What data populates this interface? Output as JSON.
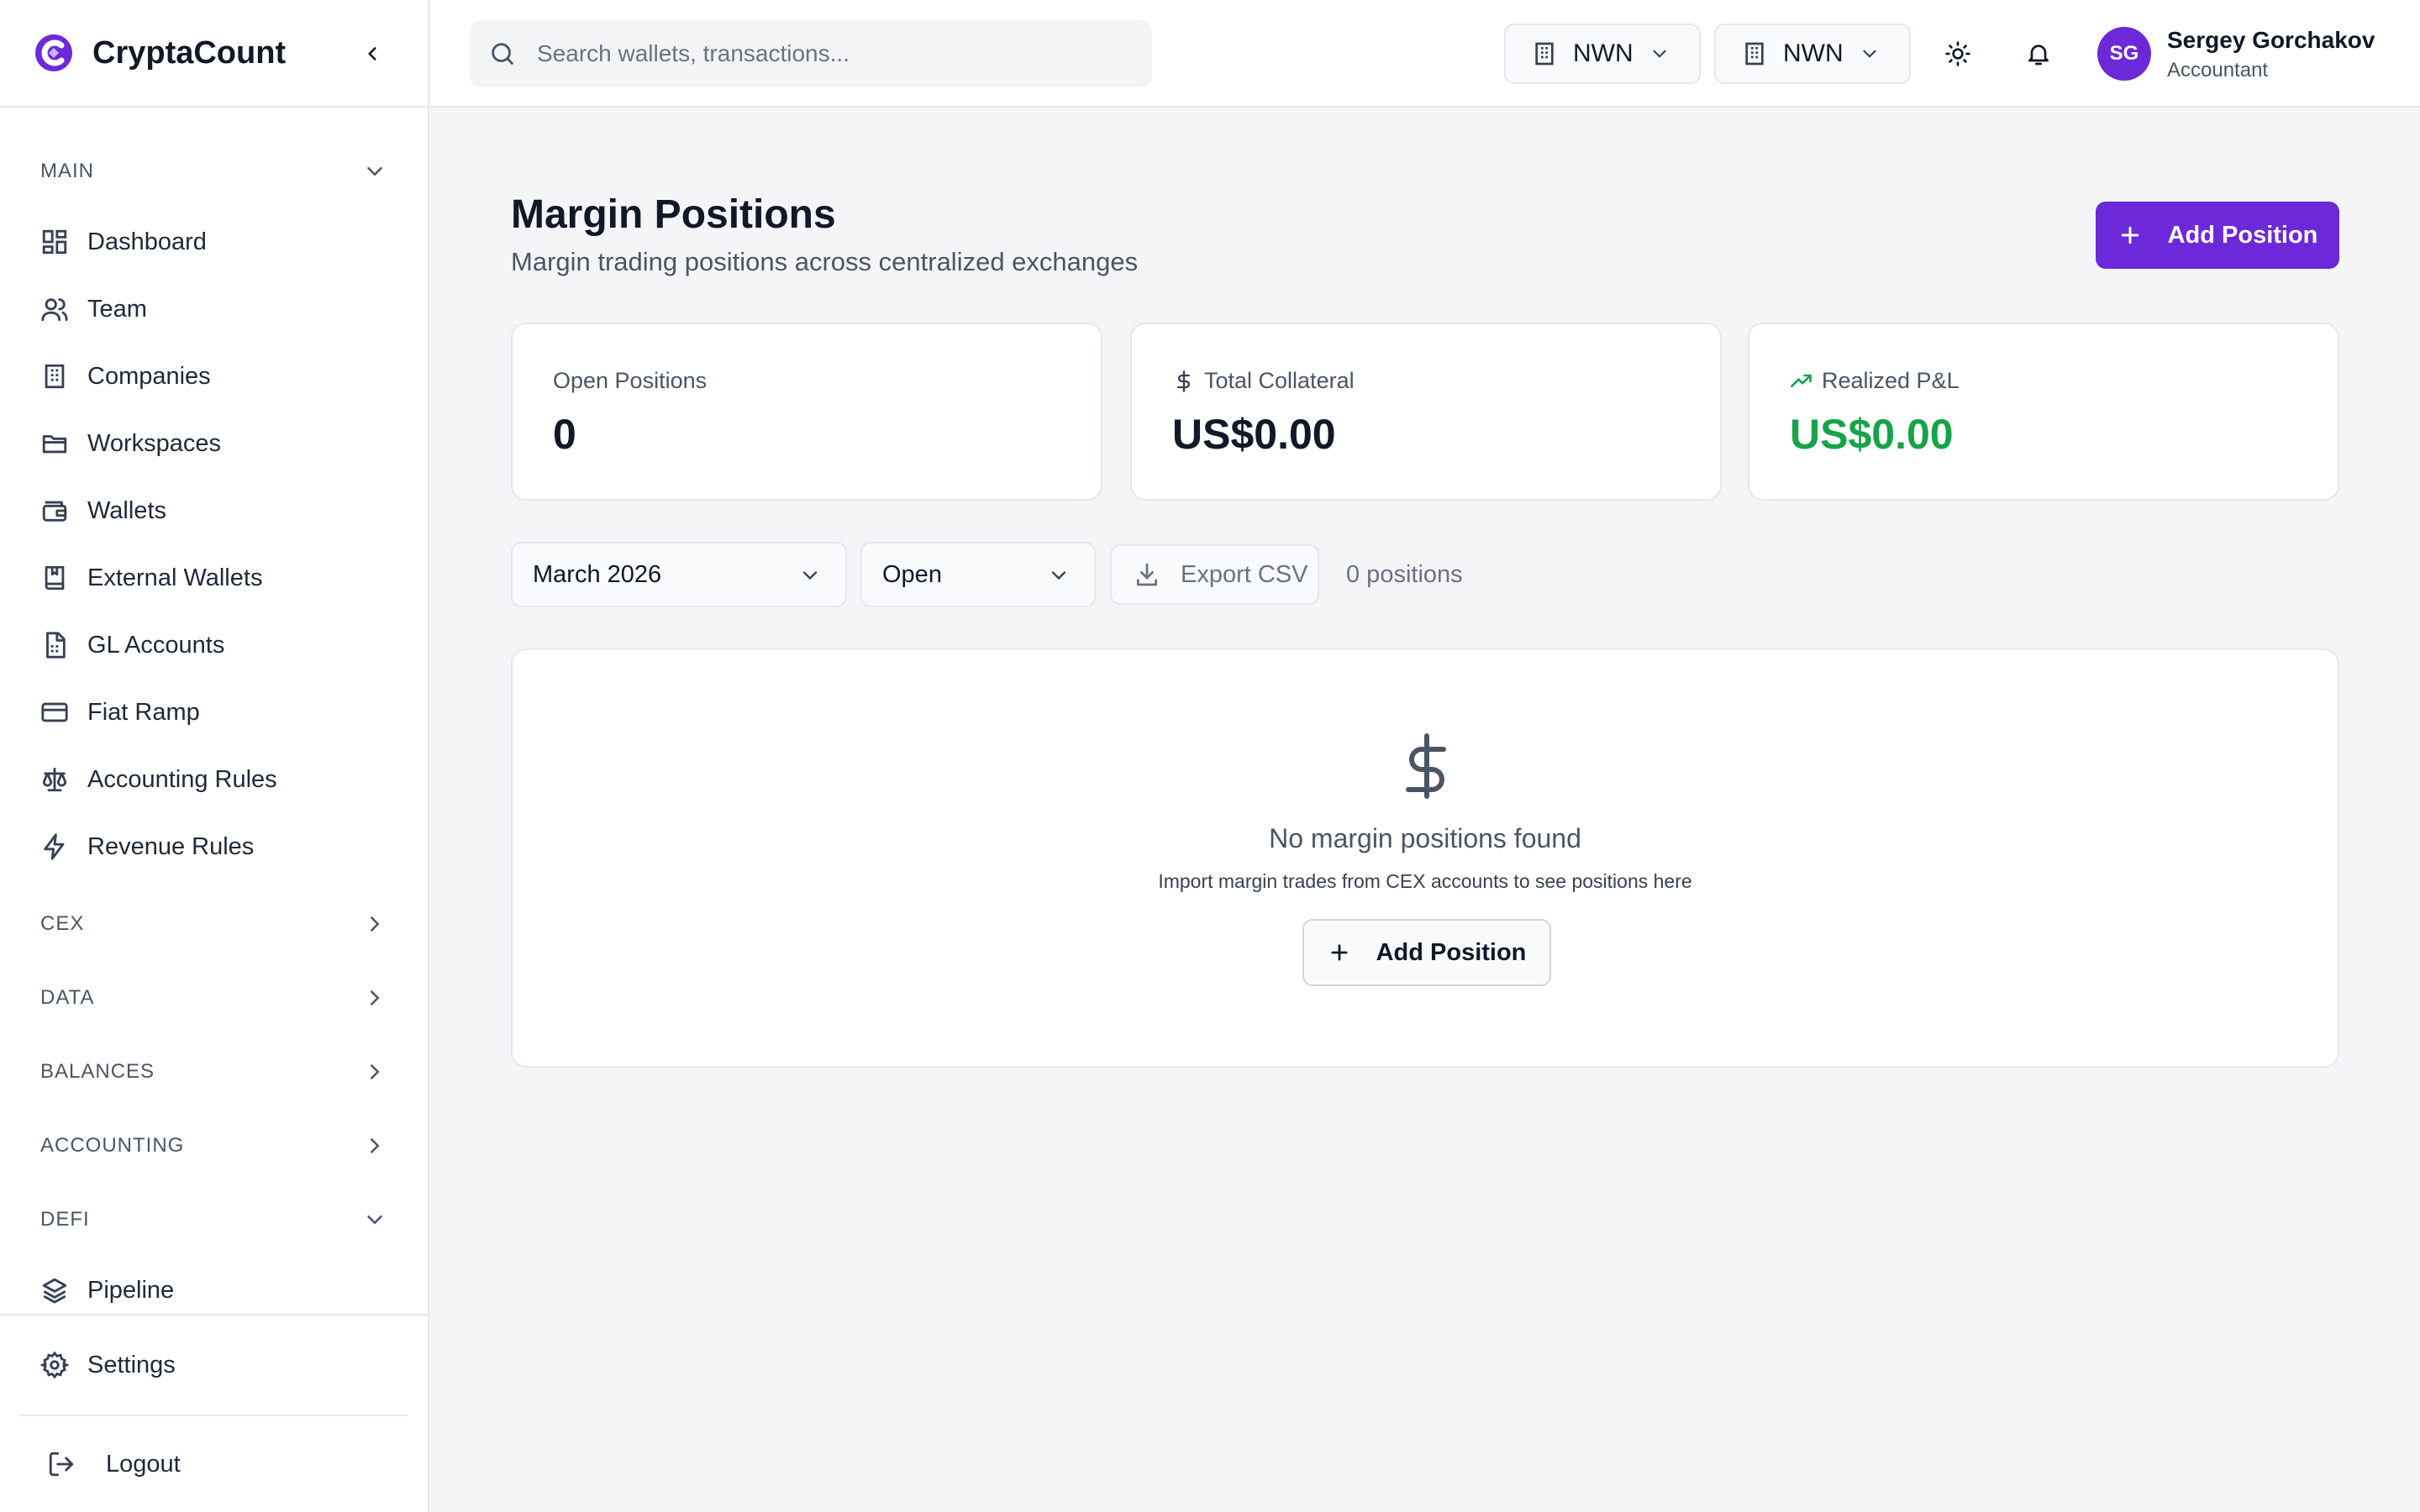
{
  "brand": {
    "name": "CryptaCount",
    "accent": "#6d28d9"
  },
  "search": {
    "placeholder": "Search wallets, transactions..."
  },
  "header": {
    "org_selectors": [
      {
        "label": "NWN"
      },
      {
        "label": "NWN"
      }
    ],
    "user": {
      "initials": "SG",
      "name": "Sergey Gorchakov",
      "role": "Accountant"
    }
  },
  "sidebar": {
    "sections": {
      "main": "MAIN",
      "cex": "CEX",
      "data": "DATA",
      "balances": "BALANCES",
      "accounting": "ACCOUNTING",
      "defi": "DEFI"
    },
    "main_items": [
      {
        "label": "Dashboard",
        "icon": "dashboard-icon"
      },
      {
        "label": "Team",
        "icon": "users-icon"
      },
      {
        "label": "Companies",
        "icon": "building-icon"
      },
      {
        "label": "Workspaces",
        "icon": "folder-icon"
      },
      {
        "label": "Wallets",
        "icon": "wallet-icon"
      },
      {
        "label": "External Wallets",
        "icon": "book-icon"
      },
      {
        "label": "GL Accounts",
        "icon": "file-spreadsheet-icon"
      },
      {
        "label": "Fiat Ramp",
        "icon": "credit-card-icon"
      },
      {
        "label": "Accounting Rules",
        "icon": "scale-icon"
      },
      {
        "label": "Revenue Rules",
        "icon": "zap-icon"
      }
    ],
    "defi_items": [
      {
        "label": "Pipeline",
        "icon": "layers-icon"
      }
    ],
    "settings": "Settings",
    "logout": "Logout"
  },
  "page": {
    "title": "Margin Positions",
    "subtitle": "Margin trading positions across centralized exchanges",
    "add_button": "Add Position"
  },
  "stats": [
    {
      "label": "Open Positions",
      "value": "0"
    },
    {
      "label": "Total Collateral",
      "value": "US$0.00"
    },
    {
      "label": "Realized P&L",
      "value": "US$0.00"
    }
  ],
  "filters": {
    "period": "March 2026",
    "status": "Open",
    "export": "Export CSV",
    "count": "0 positions"
  },
  "empty_state": {
    "title": "No margin positions found",
    "subtitle": "Import margin trades from CEX accounts to see positions here",
    "button": "Add Position"
  },
  "colors": {
    "positive": "#16a34a",
    "primary": "#6d28d9"
  }
}
